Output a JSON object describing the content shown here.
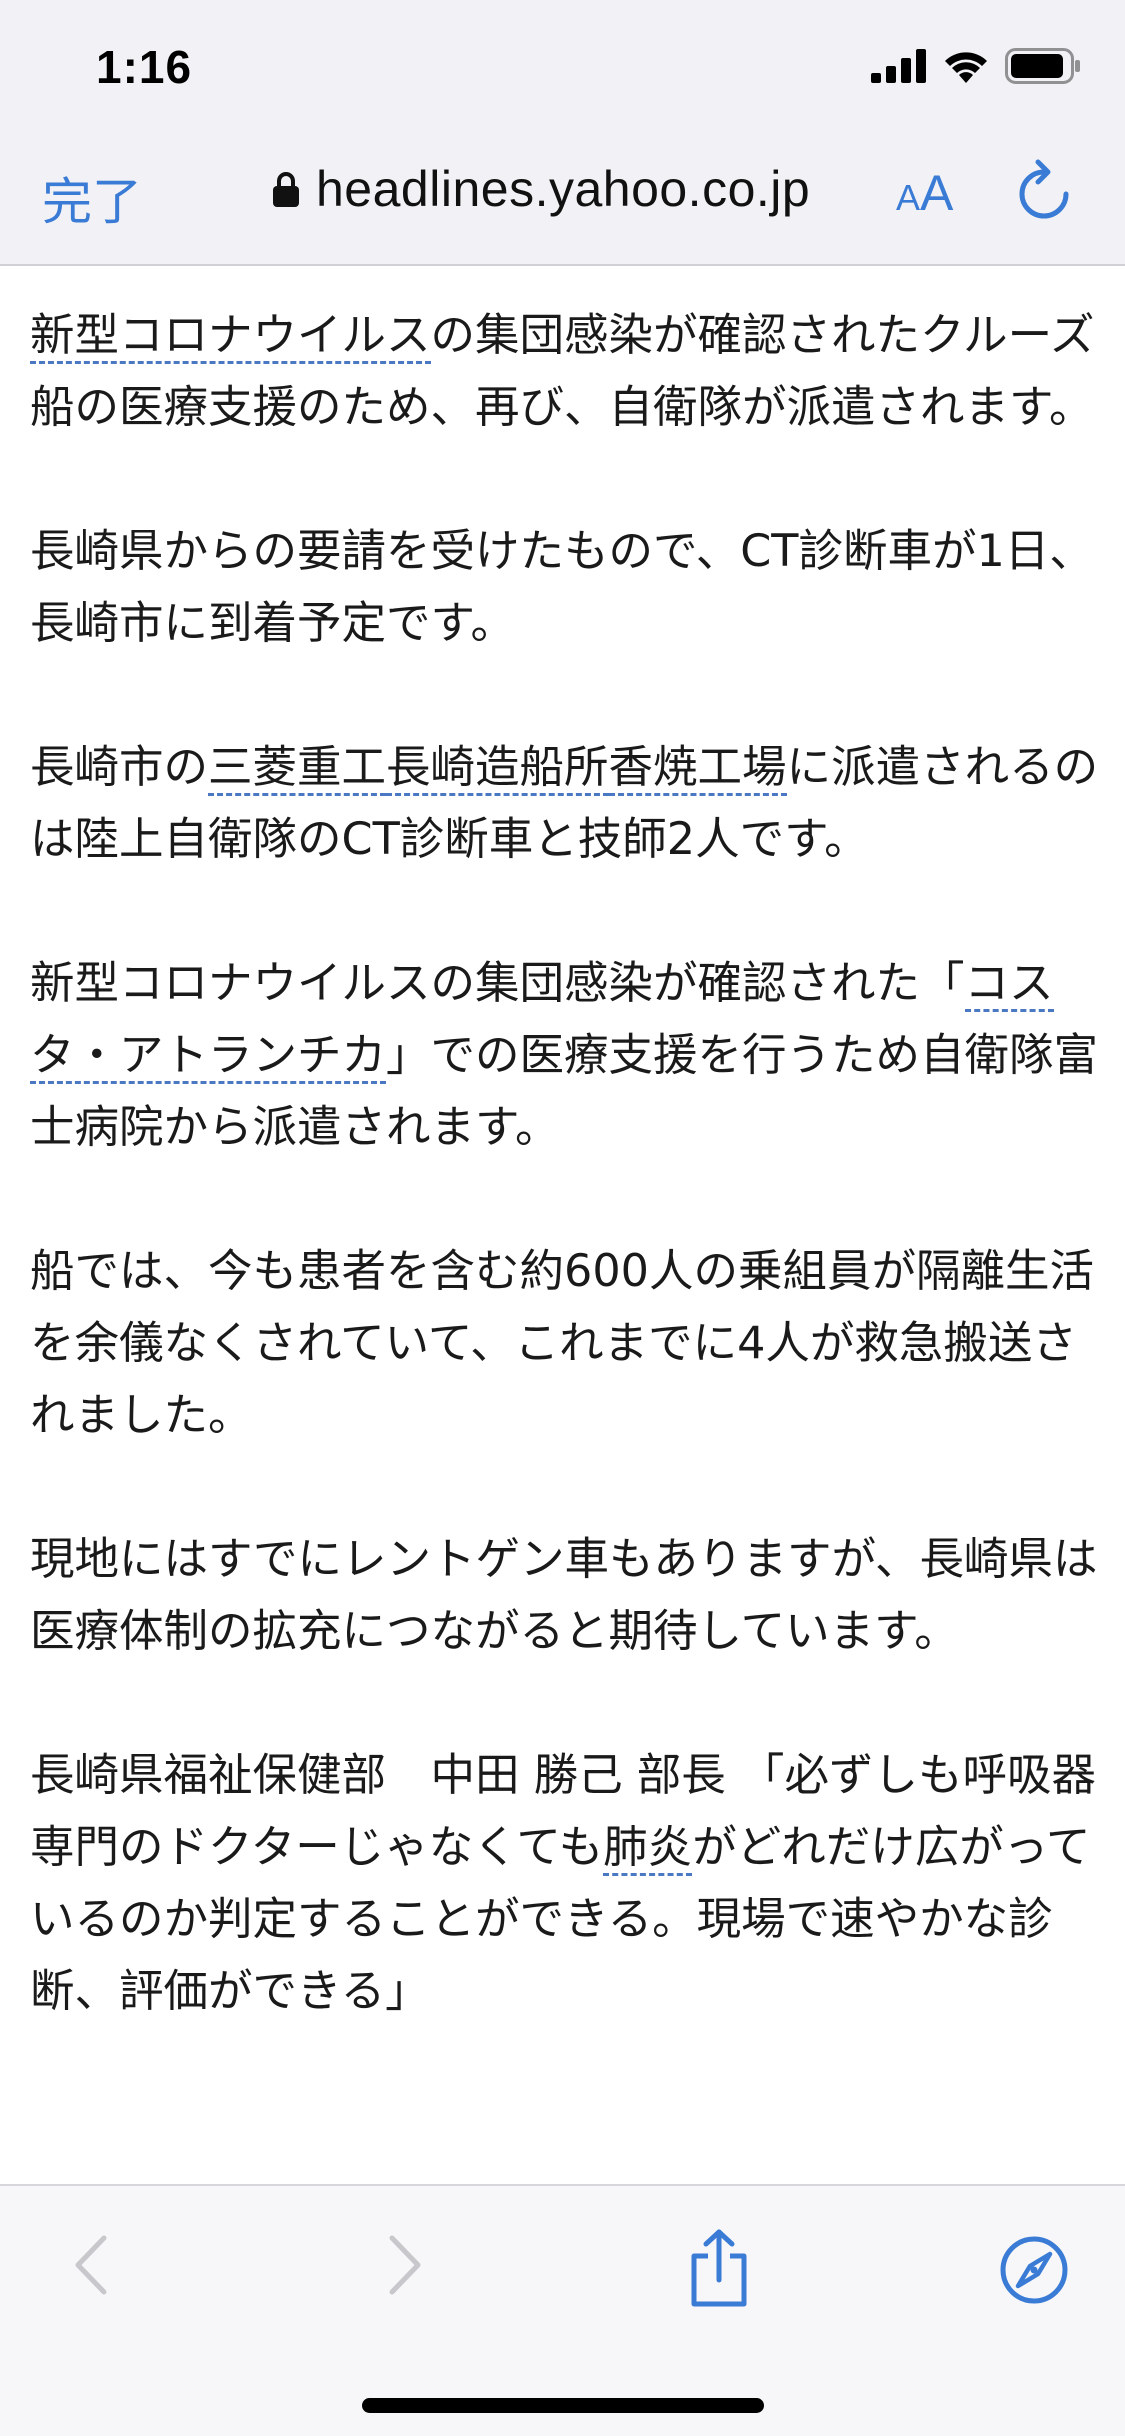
{
  "status_bar": {
    "time": "1:16"
  },
  "nav": {
    "done_label": "完了",
    "url": "headlines.yahoo.co.jp",
    "text_size_small": "A",
    "text_size_large": "A"
  },
  "article": {
    "p1": {
      "link1": "新型コロナウイルス",
      "text1": "の集団感染が確認されたクルーズ船の医療支援のため、再び、自衛隊が派遣されます。"
    },
    "p2": "長崎県からの要請を受けたもので、CT診断車が1日、長崎市に到着予定です。",
    "p3": {
      "text1": "長崎市の",
      "link1": "三菱重工",
      "link2": "長崎造船所",
      "link3": "香焼工場",
      "text2": "に派遣されるのは陸上自衛隊のCT診断車と技師2人です。"
    },
    "p4": {
      "text1": "新型コロナウイルスの集団感染が確認された「",
      "link1": "コスタ・アトランチカ",
      "text2": "」での医療支援を行うため自衛隊富士病院から派遣されます。"
    },
    "p5": "船では、今も患者を含む約600人の乗組員が隔離生活を余儀なくされていて、これまでに4人が救急搬送されました。",
    "p6": "現地にはすでにレントゲン車もありますが、長崎県は医療体制の拡充につながると期待しています。",
    "p7": {
      "text1": "長崎県福祉保健部　中田 勝己 部長 「必ずしも呼吸器専門のドクターじゃなくても",
      "link1": "肺炎",
      "text2": "がどれだけ広がっているのか判定することができる。現場で速やかな診断、評価ができる」"
    }
  },
  "colors": {
    "accent": "#3a7bd5",
    "toolbar_bg": "#f2f2f6",
    "link_underline": "#4a78c2",
    "disabled": "#c7c7cc"
  }
}
